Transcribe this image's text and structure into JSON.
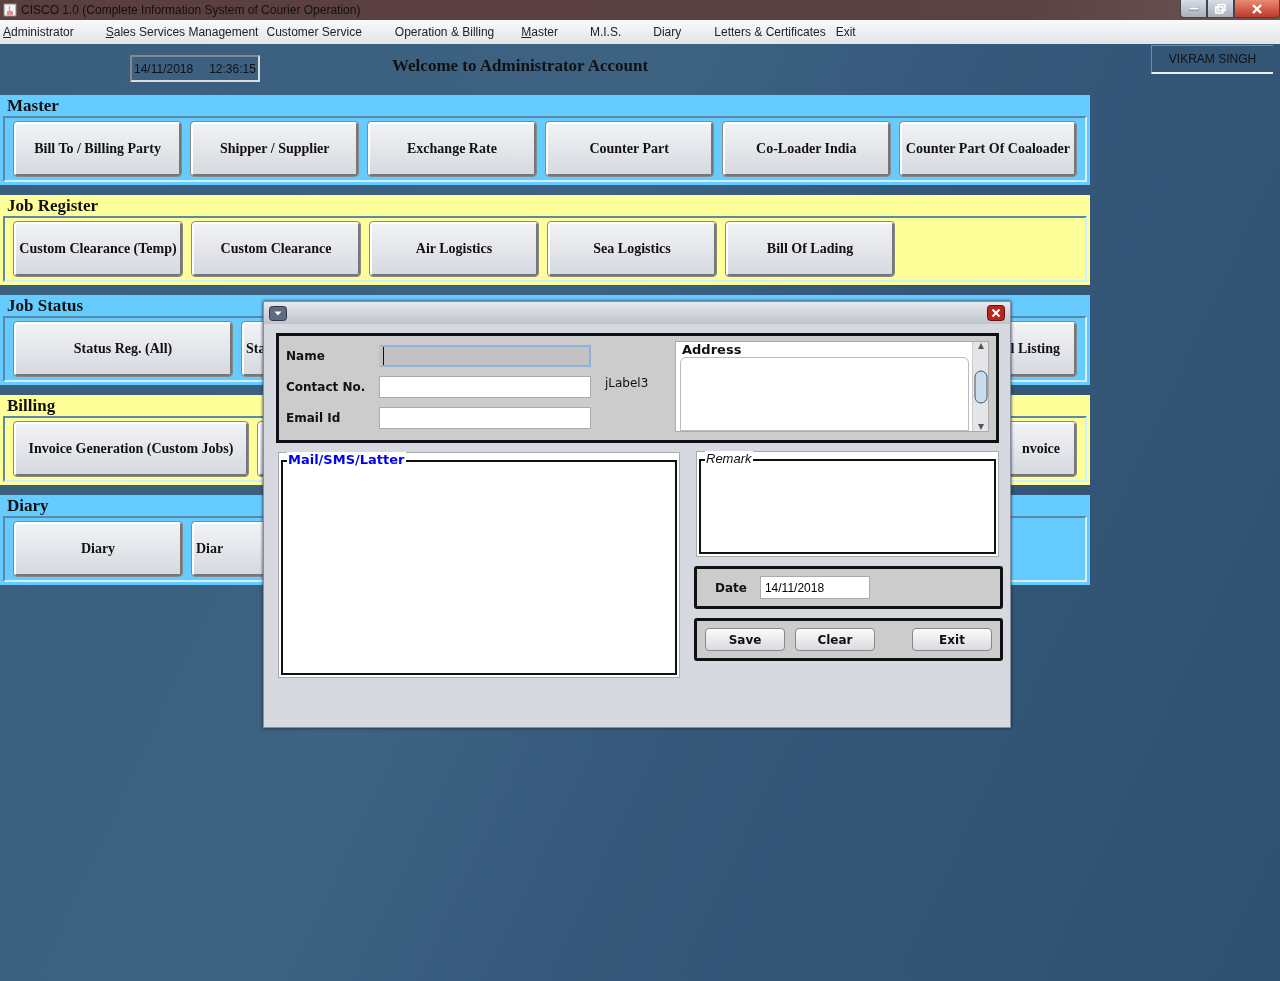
{
  "window": {
    "title": "CISCO 1.0 (Complete Information System of Courier Operation)"
  },
  "menu": [
    {
      "label": "Administrator",
      "mnemonic": true
    },
    {
      "label": "Sales Services Management",
      "mnemonic": true
    },
    {
      "label": "Customer Service",
      "mnemonic": false
    },
    {
      "label": "Operation & Billing",
      "mnemonic": false
    },
    {
      "label": "Master",
      "mnemonic": true
    },
    {
      "label": "M.I.S.",
      "mnemonic": false
    },
    {
      "label": "Diary",
      "mnemonic": false
    },
    {
      "label": "Letters & Certificates",
      "mnemonic": false
    },
    {
      "label": "Exit",
      "mnemonic": false
    }
  ],
  "header": {
    "date": "14/11/2018",
    "time": "12:36:15",
    "welcome": "Welcome to Administrator Account",
    "user": "VIKRAM SINGH"
  },
  "sections": [
    {
      "title": "Master",
      "color": "#66ccff",
      "buttons": [
        {
          "kind": "full",
          "label": "Bill To / Billing Party"
        },
        {
          "kind": "full",
          "label": "Shipper / Supplier"
        },
        {
          "kind": "full",
          "label": "Exchange Rate"
        },
        {
          "kind": "full",
          "label": "Counter Part"
        },
        {
          "kind": "full",
          "label": "Co-Loader India"
        },
        {
          "kind": "full",
          "label": "Counter Part Of Coaloader"
        }
      ]
    },
    {
      "title": "Job Register",
      "color": "#ffff99",
      "buttons": [
        {
          "kind": "full",
          "label": "Custom Clearance (Temp)"
        },
        {
          "kind": "full",
          "label": "Custom Clearance"
        },
        {
          "kind": "full",
          "label": "Air Logistics"
        },
        {
          "kind": "full",
          "label": "Sea Logistics"
        },
        {
          "kind": "full",
          "label": "Bill Of Lading"
        }
      ]
    },
    {
      "title": "Job Status",
      "color": "#66ccff",
      "buttons": [
        {
          "kind": "full",
          "label": "Status Reg. (All)"
        },
        {
          "kind": "start",
          "label": "Sta"
        },
        {
          "kind": "end",
          "label": "l Listing"
        }
      ]
    },
    {
      "title": "Billing",
      "color": "#ffff99",
      "buttons": [
        {
          "kind": "full",
          "label": "Invoice Generation (Custom Jobs)"
        },
        {
          "kind": "covered"
        },
        {
          "kind": "end",
          "label": "nvoice"
        }
      ]
    },
    {
      "title": "Diary",
      "color": "#66ccff",
      "buttons": [
        {
          "kind": "full",
          "label": "Diary"
        },
        {
          "kind": "start",
          "label": "Diar"
        }
      ]
    }
  ],
  "dialog": {
    "fields": [
      {
        "label": "Name",
        "focused": true
      },
      {
        "label": "Contact No.",
        "focused": false
      },
      {
        "label": "Email Id",
        "focused": false
      }
    ],
    "side_label": "jLabel3",
    "address": {
      "label": "Address"
    },
    "mail": {
      "label": "Mail/SMS/Latter"
    },
    "remark": {
      "label": "Remark"
    },
    "date": {
      "label": "Date",
      "value": "14/11/2018"
    },
    "buttons": [
      "Save",
      "Clear",
      "Exit"
    ]
  }
}
